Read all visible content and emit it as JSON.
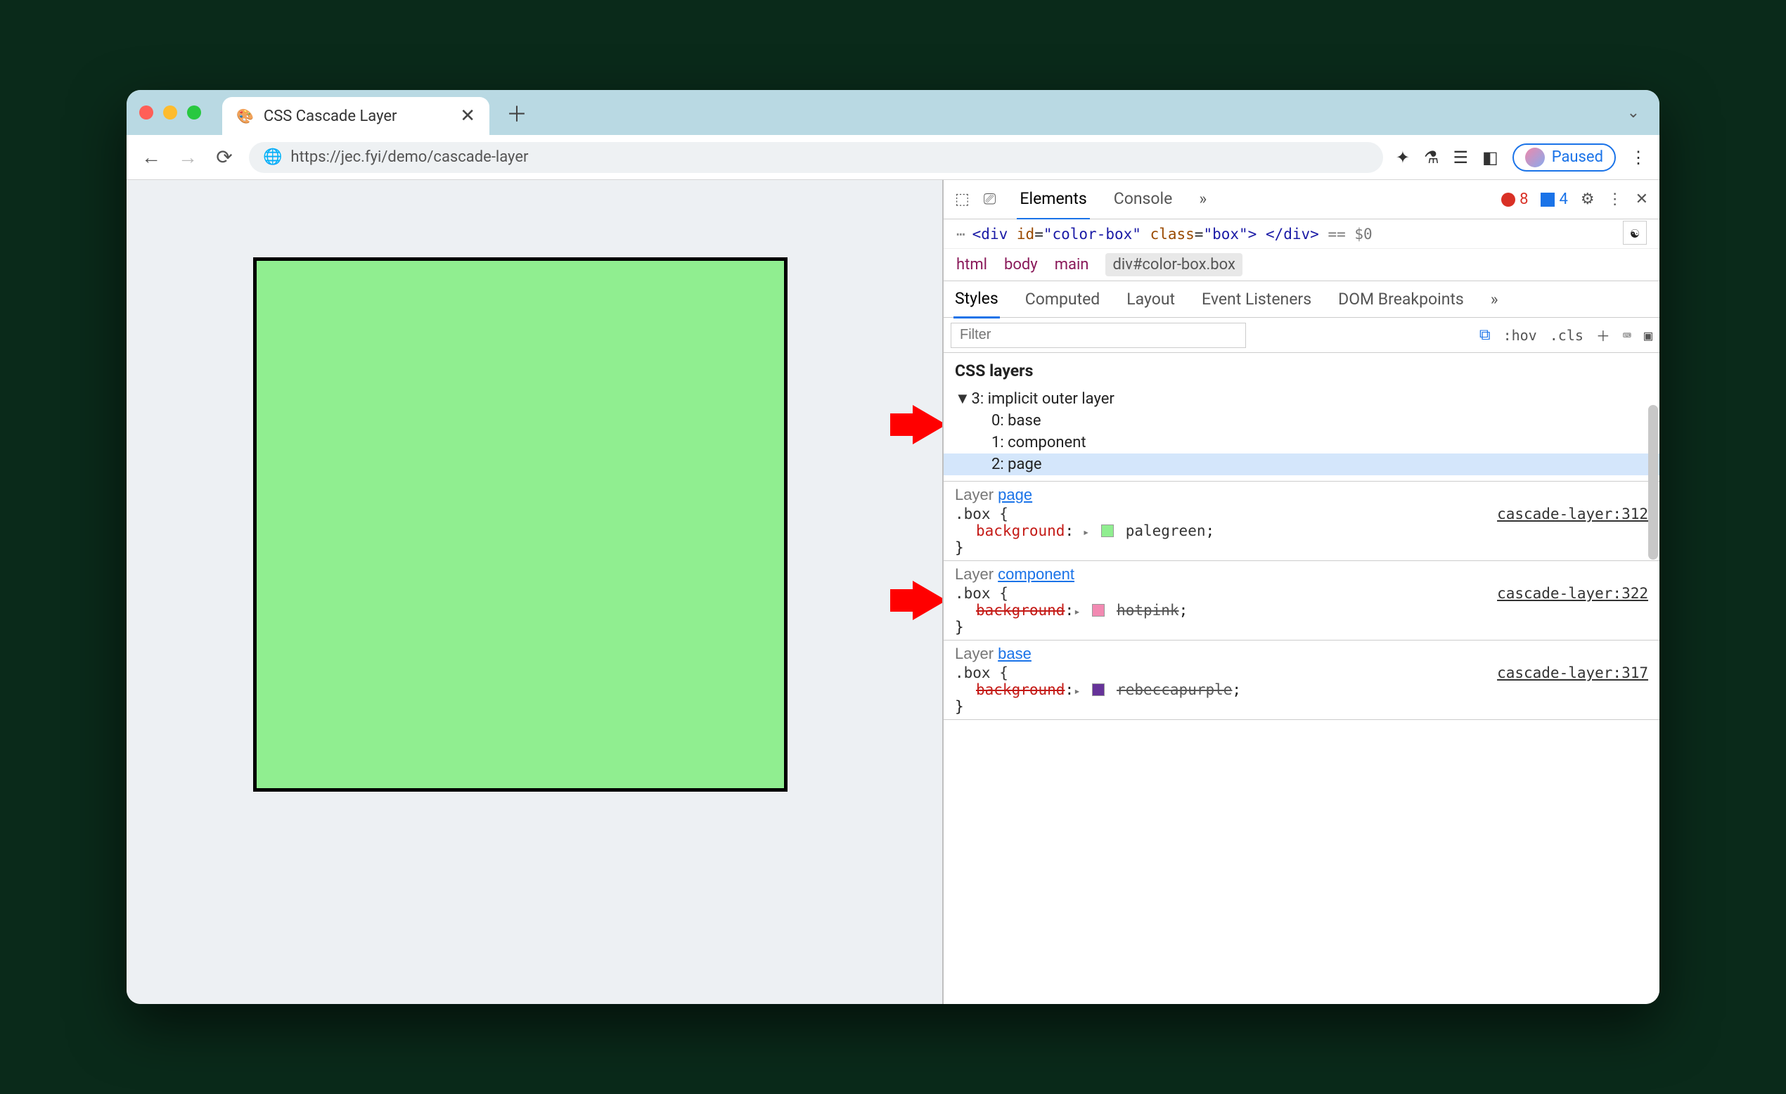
{
  "tab": {
    "title": "CSS Cascade Layer",
    "favicon": "🎨"
  },
  "address": {
    "url": "https://jec.fyi/demo/cascade-layer"
  },
  "paused": {
    "label": "Paused"
  },
  "devtools": {
    "tabs": {
      "elements": "Elements",
      "console": "Console"
    },
    "err_count": "8",
    "info_count": "4",
    "source_html": {
      "open": "<div",
      "id_attr": "id",
      "id_val": "\"color-box\"",
      "class_attr": "class",
      "class_val": "\"box\"",
      "close": "> </div>",
      "suffix": "== $0"
    }
  },
  "breadcrumb": {
    "html": "html",
    "body": "body",
    "main": "main",
    "sel": "div#color-box.box"
  },
  "styles_tabs": {
    "styles": "Styles",
    "computed": "Computed",
    "layout": "Layout",
    "listeners": "Event Listeners",
    "dom_bp": "DOM Breakpoints"
  },
  "filter": {
    "placeholder": "Filter",
    "hov": ":hov",
    "cls": ".cls"
  },
  "layers": {
    "title": "CSS layers",
    "outer": "3: implicit outer layer",
    "items": [
      {
        "label": "0: base"
      },
      {
        "label": "1: component"
      },
      {
        "label": "2: page"
      }
    ]
  },
  "rules": [
    {
      "layer_prefix": "Layer ",
      "layer_name": "page",
      "selector": ".box {",
      "source": "cascade-layer:312",
      "prop": "background",
      "value": "palegreen",
      "swatch": "#90ee90",
      "struck": false
    },
    {
      "layer_prefix": "Layer ",
      "layer_name": "component",
      "selector": ".box {",
      "source": "cascade-layer:322",
      "prop": "background",
      "value": "hotpink",
      "swatch": "#f28ab2",
      "struck": true
    },
    {
      "layer_prefix": "Layer ",
      "layer_name": "base",
      "selector": ".box {",
      "source": "cascade-layer:317",
      "prop": "background",
      "value": "rebeccapurple",
      "swatch": "#663399",
      "struck": true
    }
  ]
}
